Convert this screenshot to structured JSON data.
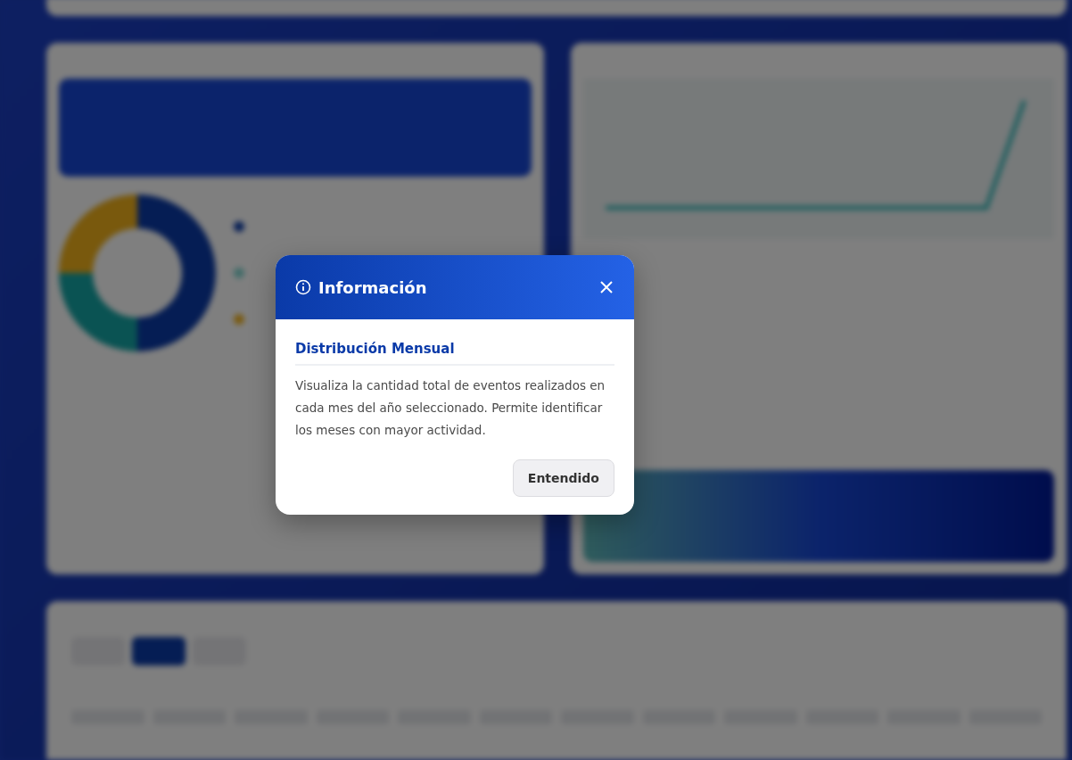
{
  "dialog": {
    "title": "Información",
    "heading": "Distribución Mensual",
    "body": "Visualiza la cantidad total de eventos realizados en cada mes del año seleccionado. Permite identificar los meses con mayor actividad.",
    "button": "Entendido"
  }
}
